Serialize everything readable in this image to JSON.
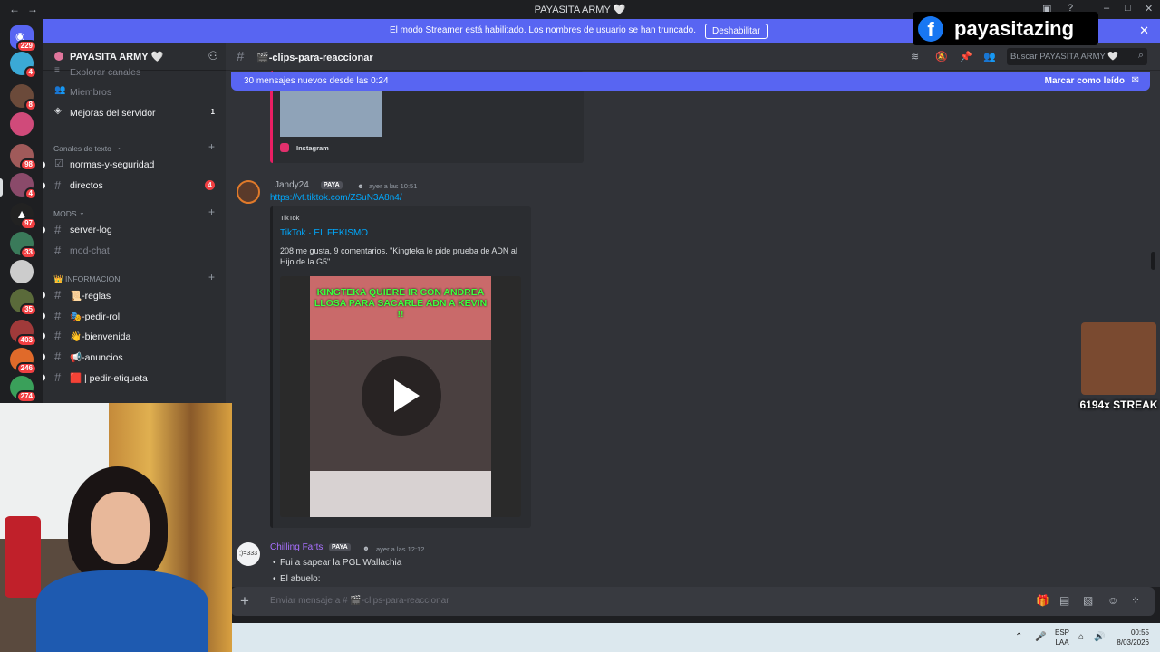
{
  "window": {
    "title": "PAYASITA ARMY 🤍",
    "back": "←",
    "forward": "→"
  },
  "streamer_banner": {
    "text": "El modo Streamer está habilitado. Los nombres de usuario se han truncado.",
    "button": "Deshabilitar"
  },
  "overlay": {
    "facebook_name": "payasitazing",
    "streak_text": "6194x STREAK"
  },
  "servers": [
    {
      "badge": "229"
    },
    {
      "badge": "4"
    },
    {
      "badge": "8"
    },
    {
      "badge": ""
    },
    {
      "badge": "98"
    },
    {
      "badge": "4"
    },
    {
      "badge": "97"
    },
    {
      "badge": "33"
    },
    {
      "badge": ""
    },
    {
      "badge": "35"
    },
    {
      "badge": "403"
    },
    {
      "badge": "246"
    },
    {
      "badge": "274"
    }
  ],
  "sidebar": {
    "server_name": "PAYASITA ARMY 🤍",
    "top_items": [
      {
        "icon": "≡",
        "label": "Explorar canales"
      },
      {
        "icon": "👥",
        "label": "Miembros"
      },
      {
        "icon": "◈",
        "label": "Mejoras del servidor",
        "count": "1"
      }
    ],
    "categories": [
      {
        "name": "Canales de texto",
        "channels": [
          {
            "icon": "☑",
            "label": "normas-y-seguridad"
          },
          {
            "icon": "#",
            "label": "directos",
            "count": "4"
          }
        ]
      },
      {
        "name": "MODS",
        "channels": [
          {
            "icon": "#",
            "label": "server-log"
          },
          {
            "icon": "#",
            "label": "mod-chat"
          }
        ]
      },
      {
        "name": "👑 INFORMACION",
        "channels": [
          {
            "icon": "#",
            "label": "📜-reglas"
          },
          {
            "icon": "#",
            "label": "🎭-pedir-rol"
          },
          {
            "icon": "#",
            "label": "👋-bienvenida"
          },
          {
            "icon": "#",
            "label": "📢-anuncios"
          },
          {
            "icon": "#",
            "label": "🟥 | pedir-etiqueta"
          }
        ]
      }
    ]
  },
  "header": {
    "channel": "🎬-clips-para-reaccionar",
    "search_placeholder": "Buscar PAYASITA ARMY 🤍"
  },
  "new_messages": {
    "text": "30 mensajes nuevos desde las 0:24",
    "mark_read": "Marcar como leído"
  },
  "messages": [
    {
      "embed_provider": "Instagram"
    },
    {
      "username": "Jandy24",
      "role_tag": "PAYA",
      "timestamp": "ayer a las 10:51",
      "link": "https://vt.tiktok.com/ZSuN3A8n4/",
      "embed": {
        "provider": "TikTok",
        "title": "TikTok · EL FEKISMO",
        "description": "208 me gusta, 9 comentarios. \"Kingteka le pide prueba de ADN al Hijo de la G5\"",
        "video_caption": "KINGTEKA QUIERE IR CON ANDREA LLOSA PARA SACARLE ADN A KEVIN !!"
      }
    },
    {
      "username": "Chilling Farts",
      "role_tag": "PAYA",
      "timestamp": "ayer a las 12:12",
      "lines": [
        "Fui a sapear la PGL Wallachia",
        "El abuelo:"
      ]
    }
  ],
  "composer": {
    "placeholder": "Enviar mensaje a # 🎬-clips-para-reaccionar"
  },
  "taskbar": {
    "lang": "ESP",
    "layout": "LAA",
    "time": "00:55",
    "date": "8/03/2026"
  },
  "colors": {
    "accent": "#5865f2",
    "link": "#00a8fc",
    "danger": "#f23f42",
    "username2": "#a970ff"
  }
}
